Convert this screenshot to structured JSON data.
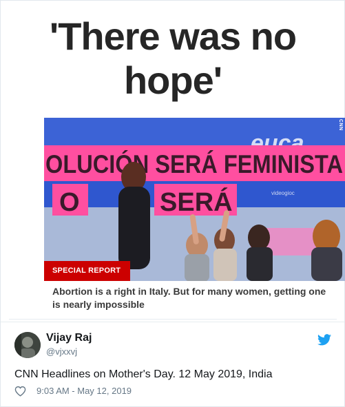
{
  "article": {
    "headline_line1": "'There was no",
    "headline_line2": "hope'",
    "badge": "SPECIAL REPORT",
    "caption": "Abortion is a right in Italy. But for many women, getting one is nearly impossible",
    "watermark": "CNN",
    "banner": {
      "row1": "OLUCIÓN SERÁ FEMINISTA",
      "row2a": "O",
      "row2b": "SERÁ",
      "sign_word": "euca",
      "sign_sub": "videogioc"
    }
  },
  "tweet": {
    "author_name": "Vijay Raj",
    "author_handle": "@vjxxvj",
    "text": "CNN Headlines on Mother's Day. 12 May 2019, India",
    "timestamp": "9:03 AM - May 12, 2019"
  },
  "icons": {
    "avatar": "avatar-photo",
    "brand": "twitter-bird-icon",
    "like": "heart-icon"
  },
  "colors": {
    "twitter_blue": "#1da1f2",
    "cnn_red": "#cc0000",
    "banner_pink": "#ff3f95",
    "muted_text": "#657786"
  }
}
